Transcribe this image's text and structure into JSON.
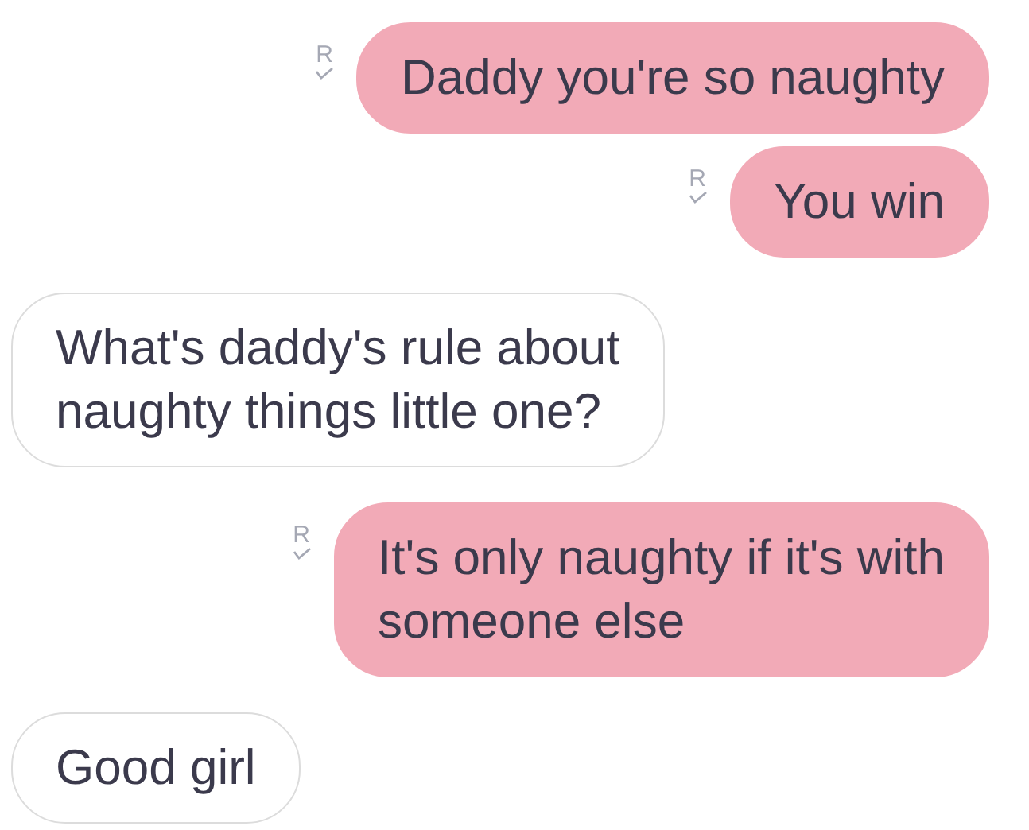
{
  "messages": [
    {
      "kind": "sent",
      "lines": [
        "Daddy you're so naughty"
      ],
      "receipt": "R"
    },
    {
      "kind": "sent",
      "lines": [
        "You win"
      ],
      "receipt": "R"
    },
    {
      "kind": "received",
      "lines": [
        "What's daddy's rule about",
        "naughty things little one?"
      ]
    },
    {
      "kind": "sent",
      "lines": [
        "It's only naughty if it's with",
        "someone else"
      ],
      "receipt": "R"
    },
    {
      "kind": "received",
      "lines": [
        "Good girl"
      ]
    }
  ]
}
